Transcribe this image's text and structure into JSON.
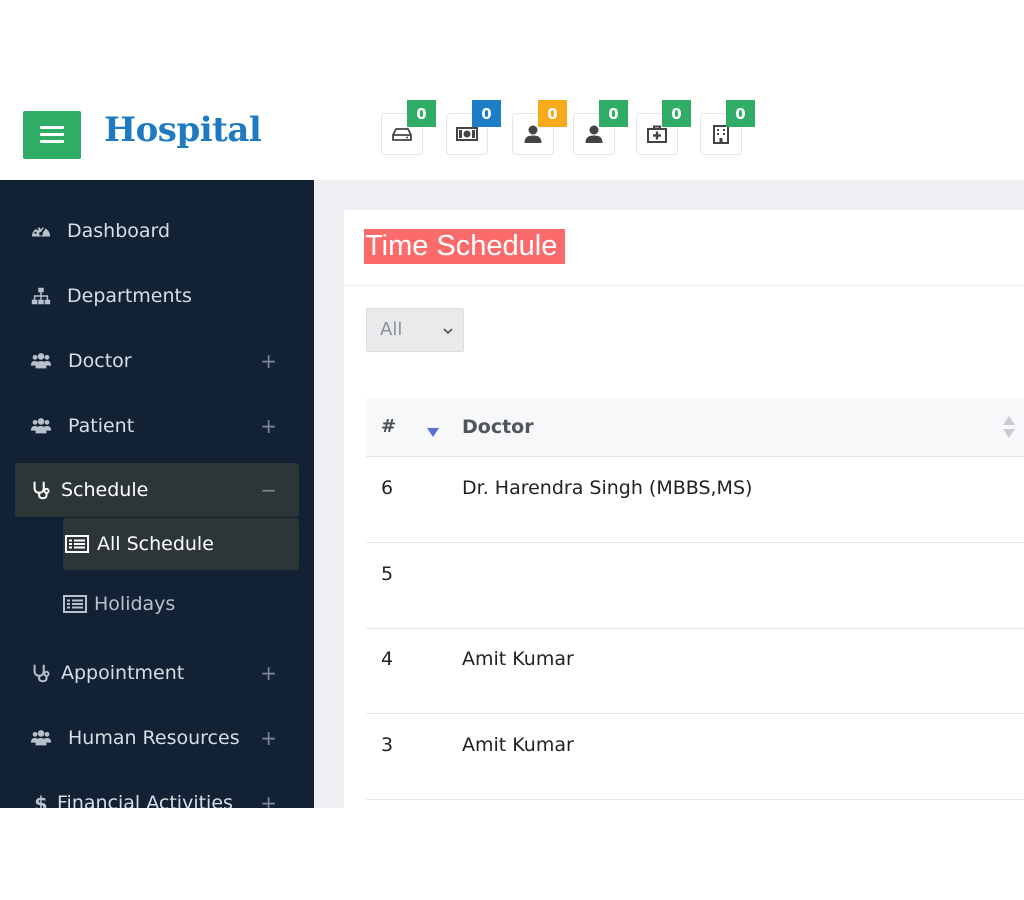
{
  "header": {
    "logo_text": "Hospital",
    "notifications": [
      {
        "icon": "hdd-icon",
        "count": "0",
        "color": "#2fac66"
      },
      {
        "icon": "money-icon",
        "count": "0",
        "color": "#1d7ec7"
      },
      {
        "icon": "user-icon",
        "count": "0",
        "color": "#f6aa1c"
      },
      {
        "icon": "user-icon",
        "count": "0",
        "color": "#2fac66"
      },
      {
        "icon": "medkit-icon",
        "count": "0",
        "color": "#2fac66"
      },
      {
        "icon": "hospital-icon",
        "count": "0",
        "color": "#2fac66"
      }
    ]
  },
  "sidebar": {
    "items": [
      {
        "label": "Dashboard",
        "icon": "dashboard-icon"
      },
      {
        "label": "Departments",
        "icon": "sitemap-icon"
      },
      {
        "label": "Doctor",
        "icon": "users-icon",
        "toggle": "+"
      },
      {
        "label": "Patient",
        "icon": "users-icon",
        "toggle": "+"
      },
      {
        "label": "Schedule",
        "icon": "stethoscope-icon",
        "toggle": "−",
        "active": true,
        "children": [
          {
            "label": "All Schedule",
            "icon": "list-icon",
            "active": true
          },
          {
            "label": "Holidays",
            "icon": "list-icon"
          }
        ]
      },
      {
        "label": "Appointment",
        "icon": "stethoscope-icon",
        "toggle": "+"
      },
      {
        "label": "Human Resources",
        "icon": "users-icon",
        "toggle": "+"
      },
      {
        "label": "Financial Activities",
        "icon": "dollar-icon",
        "toggle": "+"
      }
    ]
  },
  "main": {
    "title": "Time Schedule",
    "filter": {
      "selected": "All"
    },
    "table": {
      "columns": [
        "#",
        "Doctor"
      ],
      "rows": [
        {
          "num": "6",
          "doctor": "Dr. Harendra Singh (MBBS,MS)"
        },
        {
          "num": "5",
          "doctor": ""
        },
        {
          "num": "4",
          "doctor": "Amit Kumar"
        },
        {
          "num": "3",
          "doctor": "Amit Kumar"
        }
      ]
    }
  },
  "colors": {
    "brand_green": "#2fac66",
    "logo_blue": "#1f7bc1",
    "sidebar_bg": "#122134",
    "title_highlight": "#fb6b6b"
  }
}
